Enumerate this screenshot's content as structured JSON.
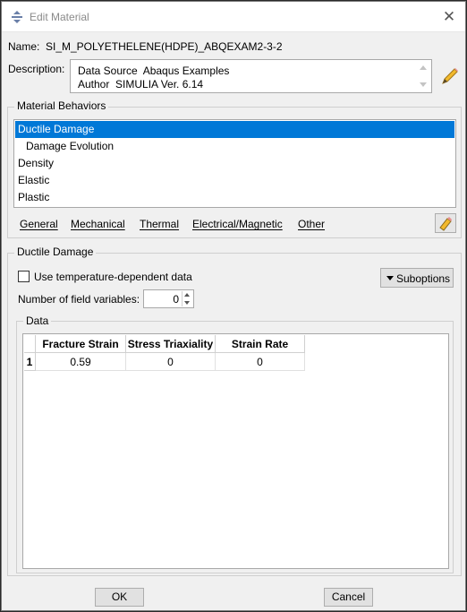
{
  "window": {
    "title": "Edit Material",
    "close_glyph": "✕"
  },
  "name": {
    "label": "Name:",
    "value": "SI_M_POLYETHELENE(HDPE)_ABQEXAM2-3-2"
  },
  "description": {
    "label": "Description:",
    "lines": [
      "Data Source  Abaqus Examples",
      "Author  SIMULIA Ver. 6.14"
    ]
  },
  "material_behaviors": {
    "title": "Material Behaviors",
    "items": [
      {
        "label": "Ductile Damage",
        "selected": true
      },
      {
        "label": "Damage Evolution",
        "selected": false
      },
      {
        "label": "Density",
        "selected": false
      },
      {
        "label": "Elastic",
        "selected": false
      },
      {
        "label": "Plastic",
        "selected": false
      }
    ],
    "selection_color": "#0078d7"
  },
  "menu": {
    "items": [
      "General",
      "Mechanical",
      "Thermal",
      "Electrical/Magnetic",
      "Other"
    ]
  },
  "ductile_damage": {
    "section_title": "Ductile Damage",
    "temperature_checkbox_label": "Use temperature-dependent data",
    "temperature_checked": false,
    "suboptions_label": "Suboptions",
    "field_variables_label": "Number of field variables:",
    "field_variables_value": "0"
  },
  "data": {
    "group_title": "Data",
    "columns": [
      "Fracture Strain",
      "Stress Triaxiality",
      "Strain Rate"
    ],
    "rows": [
      {
        "index": "1",
        "cells": [
          "0.59",
          "0",
          "0"
        ]
      }
    ]
  },
  "buttons": {
    "ok": "OK",
    "cancel": "Cancel"
  },
  "icons": {
    "app": "move-arrows-icon",
    "edit": "pencil-icon",
    "clear": "eraser-icon"
  }
}
